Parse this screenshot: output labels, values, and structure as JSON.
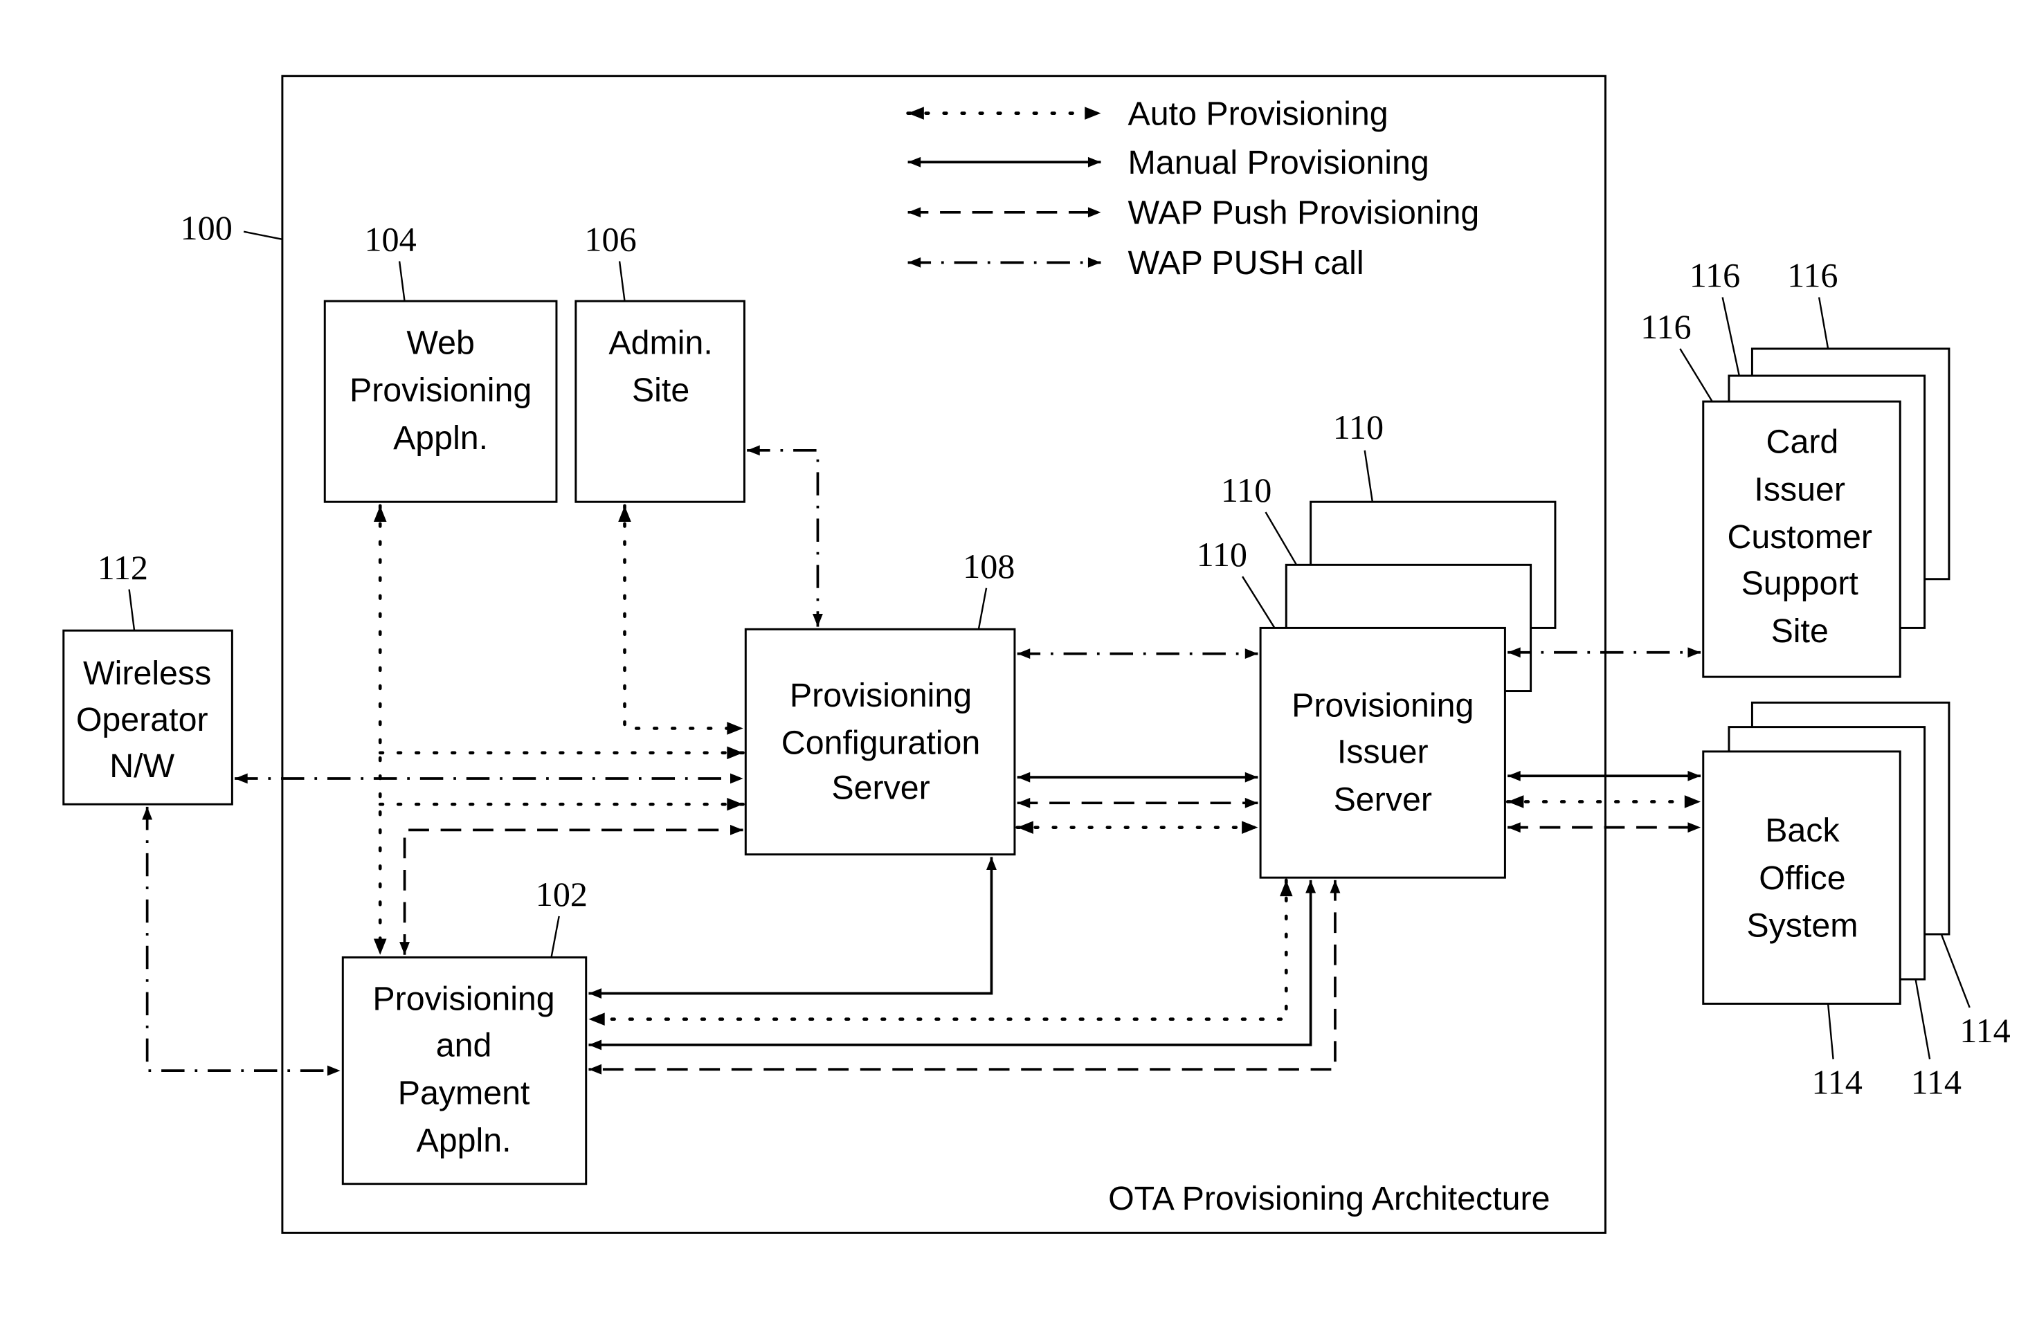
{
  "caption": "OTA Provisioning Architecture",
  "legend": [
    {
      "style": "auto",
      "label": "Auto Provisioning"
    },
    {
      "style": "manual",
      "label": "Manual Provisioning"
    },
    {
      "style": "push",
      "label": "WAP Push Provisioning"
    },
    {
      "style": "call",
      "label": "WAP PUSH call"
    }
  ],
  "nodes": {
    "web": {
      "lines": [
        "Web",
        "Provisioning",
        "Appln."
      ],
      "ref": "104"
    },
    "admin": {
      "lines": [
        "Admin.",
        "Site"
      ],
      "ref": "106"
    },
    "config": {
      "lines": [
        "Provisioning",
        "Configuration",
        "Server"
      ],
      "ref": "108"
    },
    "issuer": {
      "lines": [
        "Provisioning",
        "Issuer",
        "Server"
      ],
      "ref": "110"
    },
    "payment": {
      "lines": [
        "Provisioning",
        "and",
        "Payment",
        "Appln."
      ],
      "ref": "102"
    },
    "wireless": {
      "lines": [
        "Wireless",
        "Operator",
        "N/W"
      ],
      "ref": "112"
    },
    "card": {
      "lines": [
        "Card",
        "Issuer",
        "Customer",
        "Support",
        "Site"
      ],
      "ref": "116"
    },
    "backoffice": {
      "lines": [
        "Back",
        "Office",
        "System"
      ],
      "ref": "114"
    }
  },
  "system_ref": "100"
}
